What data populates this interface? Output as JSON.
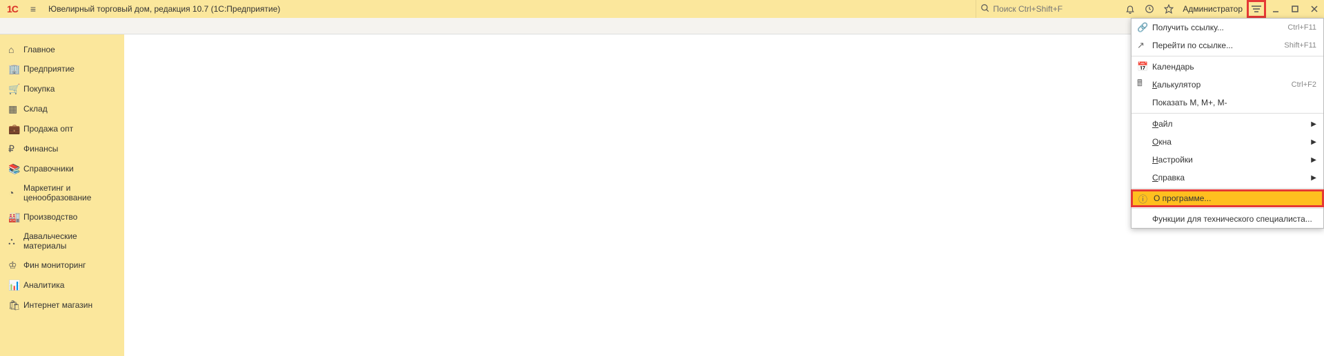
{
  "titlebar": {
    "logo": "1С",
    "title": "Ювелирный торговый дом, редакция 10.7  (1С:Предприятие)",
    "search_placeholder": "Поиск Ctrl+Shift+F",
    "user": "Администратор"
  },
  "sidebar": {
    "items": [
      {
        "icon": "⌂",
        "label": "Главное"
      },
      {
        "icon": "🏢",
        "label": "Предприятие"
      },
      {
        "icon": "🛒",
        "label": "Покупка"
      },
      {
        "icon": "▦",
        "label": "Склад"
      },
      {
        "icon": "💼",
        "label": "Продажа опт"
      },
      {
        "icon": "₽",
        "label": "Финансы"
      },
      {
        "icon": "📚",
        "label": "Справочники"
      },
      {
        "icon": "◔",
        "label": "Маркетинг и ценообразование"
      },
      {
        "icon": "🏭",
        "label": "Производство"
      },
      {
        "icon": "⛬",
        "label": "Давальческие материалы"
      },
      {
        "icon": "♔",
        "label": "Фин мониторинг"
      },
      {
        "icon": "📊",
        "label": "Аналитика"
      },
      {
        "icon": "🛍",
        "label": "Интернет магазин"
      }
    ]
  },
  "dropdown": {
    "items": [
      {
        "icon": "🔗",
        "label": "Получить ссылку...",
        "shortcut": "Ctrl+F11"
      },
      {
        "icon": "↗",
        "label": "Перейти по ссылке...",
        "shortcut": "Shift+F11"
      },
      {
        "type": "sep"
      },
      {
        "icon": "📅",
        "label": "Календарь"
      },
      {
        "icon": "🖩",
        "label_u": "К",
        "label_rest": "алькулятор",
        "shortcut": "Ctrl+F2"
      },
      {
        "icon": "",
        "label": "Показать M, M+, M-"
      },
      {
        "type": "sep"
      },
      {
        "icon": "",
        "label_u": "Ф",
        "label_rest": "айл",
        "arrow": true
      },
      {
        "icon": "",
        "label_u": "О",
        "label_rest": "кна",
        "arrow": true
      },
      {
        "icon": "",
        "label_u": "Н",
        "label_rest": "астройки",
        "arrow": true
      },
      {
        "icon": "",
        "label_u": "С",
        "label_rest": "правка",
        "arrow": true
      },
      {
        "type": "sep"
      },
      {
        "icon": "ⓘ",
        "label": "О программе...",
        "highlighted": true,
        "red_border": true
      },
      {
        "type": "sep"
      },
      {
        "icon": "",
        "label": "Функции для технического специалиста..."
      }
    ]
  }
}
